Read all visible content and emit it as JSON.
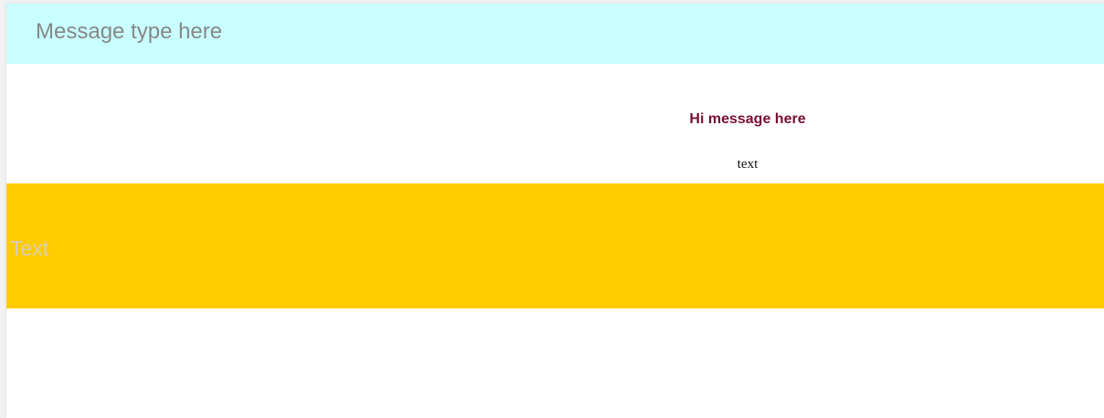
{
  "message_bar": {
    "placeholder": "Message type here",
    "value": ""
  },
  "content": {
    "heading": "Hi message here",
    "body_text": "text"
  },
  "banner": {
    "text": "Text"
  }
}
